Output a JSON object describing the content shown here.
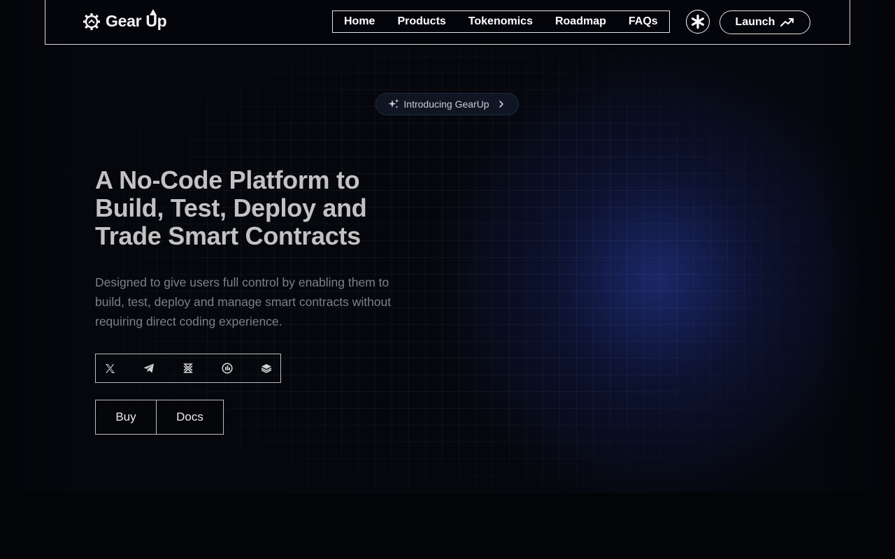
{
  "brand": {
    "name": "Gear Up"
  },
  "nav": {
    "items": [
      {
        "label": "Home"
      },
      {
        "label": "Products"
      },
      {
        "label": "Tokenomics"
      },
      {
        "label": "Roadmap"
      },
      {
        "label": "FAQs"
      }
    ],
    "launch_label": "Launch"
  },
  "hero": {
    "pill_label": "Introducing GearUp",
    "headline_lines": [
      "A No-Code Platform to",
      "Build, Test, Deploy and",
      "Trade Smart Contracts"
    ],
    "subtext_lines": [
      "Designed to give users full control by enabling them to",
      "build, test, deploy and manage smart contracts without",
      "requiring direct coding experience."
    ],
    "socials": [
      {
        "icon": "x-icon"
      },
      {
        "icon": "telegram-icon"
      },
      {
        "icon": "dextools-icon"
      },
      {
        "icon": "dexscreener-icon"
      },
      {
        "icon": "gitbook-icon"
      }
    ],
    "buy_label": "Buy",
    "docs_label": "Docs"
  },
  "colors": {
    "background": "#05070c",
    "glow": "#1e2d78",
    "headline": "#c2c2c2",
    "subtext": "#7e8087",
    "border": "#bdbdbd"
  }
}
